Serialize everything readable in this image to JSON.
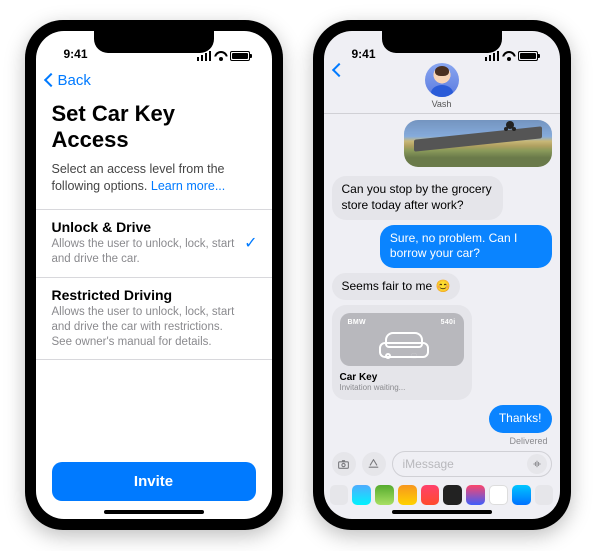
{
  "status": {
    "time": "9:41"
  },
  "left": {
    "back": "Back",
    "title": "Set Car Key Access",
    "subtitle": "Select an access level from the following options.",
    "learn_more": "Learn more...",
    "options": [
      {
        "title": "Unlock & Drive",
        "desc": "Allows the user to unlock, lock, start and drive the car.",
        "selected": true
      },
      {
        "title": "Restricted Driving",
        "desc": "Allows the user to unlock, lock, start and drive the car with restrictions. See owner's manual for details.",
        "selected": false
      }
    ],
    "invite": "Invite"
  },
  "right": {
    "contact": "Vash",
    "messages": {
      "m1": "Can you stop by the grocery store today after work?",
      "m2": "Sure, no problem. Can I borrow your car?",
      "m3_prefix": "Seems fair to me ",
      "m3_emoji": "😊",
      "m4": "Thanks!"
    },
    "key_card": {
      "brand": "BMW",
      "model": "540i",
      "title": "Car Key",
      "status": "Invitation waiting..."
    },
    "delivered": "Delivered",
    "input_placeholder": "iMessage",
    "app_colors": [
      "#e6e6ea",
      "#4a90e2",
      "#34c759",
      "#ffcc00",
      "#ff3b30",
      "#8e8e93",
      "#ff2d55",
      "#af52de",
      "#5ac8fa",
      "#d0d0d5"
    ]
  }
}
